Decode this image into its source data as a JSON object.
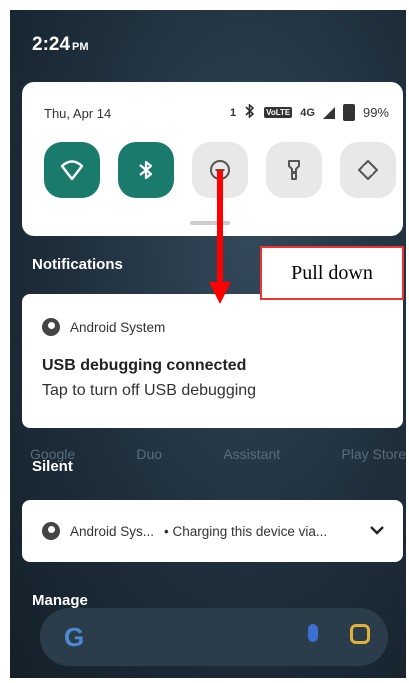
{
  "status_bar": {
    "time": "2:24",
    "ampm": "PM"
  },
  "quick_settings": {
    "date": "Thu, Apr 14",
    "indicator_count": "1",
    "volte_label": "VoLTE",
    "network": "4G",
    "battery": "99%",
    "tiles": [
      {
        "name": "wifi",
        "icon": "wifi-icon",
        "on": true
      },
      {
        "name": "bluetooth",
        "icon": "bluetooth-icon",
        "on": true
      },
      {
        "name": "do-not-disturb",
        "icon": "dnd-icon",
        "on": false
      },
      {
        "name": "flashlight",
        "icon": "flashlight-icon",
        "on": false
      },
      {
        "name": "auto-rotate",
        "icon": "rotate-icon",
        "on": false
      }
    ]
  },
  "notifications": {
    "header": "Notifications",
    "items": [
      {
        "app": "Android System",
        "title": "USB debugging connected",
        "body": "Tap to turn off USB debugging"
      }
    ]
  },
  "silent": {
    "header": "Silent",
    "items": [
      {
        "app": "Android Sys...",
        "summary": "• Charging this device via..."
      }
    ]
  },
  "manage_label": "Manage",
  "background_app_labels": [
    "Google",
    "Duo",
    "Assistant",
    "Play Store"
  ],
  "annotation": {
    "label": "Pull down",
    "color": "#ff0000"
  },
  "colors": {
    "tile_on": "#1a7a6c",
    "tile_off": "#e8e8e8"
  }
}
